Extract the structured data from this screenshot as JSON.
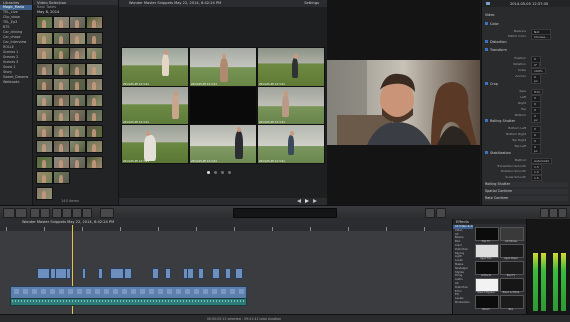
{
  "library": {
    "header": "Libraries",
    "items": [
      {
        "label": "Magic_Maria",
        "selected": true
      },
      {
        "label": "TEL_Live",
        "selected": false
      },
      {
        "label": "Clip_show",
        "selected": false
      },
      {
        "label": "TEL_Ep3",
        "selected": false
      },
      {
        "label": "BTS",
        "selected": false
      },
      {
        "label": "Car_driving",
        "selected": false
      },
      {
        "label": "Car_chase",
        "selected": false
      },
      {
        "label": "Car_Interview",
        "selected": false
      },
      {
        "label": "ROLLE",
        "selected": false
      },
      {
        "label": "Scenes 1",
        "selected": false
      },
      {
        "label": "Scenes 2",
        "selected": false
      },
      {
        "label": "Scenes 3",
        "selected": false
      },
      {
        "label": "Snow 1",
        "selected": false
      },
      {
        "label": "Story",
        "selected": false
      },
      {
        "label": "Sweet_Dreams",
        "selected": false
      },
      {
        "label": "Webisode",
        "selected": false
      }
    ]
  },
  "browser": {
    "header": "Video Selection",
    "subheader": "Best Takes",
    "date_label": "May 8, 2014",
    "footer": "140 items"
  },
  "viewer_grid": {
    "title": "Wonder Master Snippets May 22, 2014, 6:42:24 PM",
    "settings_label": "Settings",
    "timecodes": [
      "2014-05-05 12:3:21",
      "2014-05-05 12:3:21",
      "2014-05-05 12:3:21",
      "2014-05-05 12:3:21",
      "",
      "2014-05-05 12:3:21",
      "2014-05-05 12:3:21",
      "2014-05-05 12:3:21",
      "2014-05-05 12:3:21"
    ]
  },
  "inspector": {
    "header": "2014-05-05 12:37:45",
    "sections": {
      "video": "Video",
      "color": "Color",
      "distortion": "Distortion",
      "transform": "Transform",
      "crop": "Crop",
      "spatial": "Spatial Conform",
      "rolling": "Rolling Shutter",
      "stabilization": "Stabilization",
      "rate": "Rate Conform"
    },
    "color_props": [
      {
        "label": "Balance",
        "value": "Not Analyzed"
      },
      {
        "label": "Match Color",
        "value": "Choose..."
      }
    ],
    "transform_props": [
      {
        "label": "Position",
        "value": "0 px"
      },
      {
        "label": "Rotation",
        "value": "0°"
      },
      {
        "label": "Scale",
        "value": "100%"
      },
      {
        "label": "Anchor",
        "value": "0 px"
      }
    ],
    "crop_props": [
      {
        "label": "Type",
        "value": "Trim"
      },
      {
        "label": "Left",
        "value": "0 px"
      },
      {
        "label": "Right",
        "value": "0 px"
      },
      {
        "label": "Top",
        "value": "0 px"
      },
      {
        "label": "Bottom",
        "value": "0 px"
      }
    ],
    "distort_props": [
      {
        "label": "Bottom Left",
        "value": "0 px"
      },
      {
        "label": "Bottom Right",
        "value": "0 px"
      },
      {
        "label": "Top Right",
        "value": "0 px"
      },
      {
        "label": "Top Left",
        "value": "0 px"
      }
    ],
    "stab_props": [
      {
        "label": "Method",
        "value": "Automatic"
      },
      {
        "label": "Translation Smooth",
        "value": "1.5"
      },
      {
        "label": "Rotation Smooth",
        "value": "1.5"
      },
      {
        "label": "Scale Smooth",
        "value": "1.5"
      }
    ]
  },
  "timeline": {
    "project_name": "Wonder Master Snippets May 22, 2014, 6:42:24 PM"
  },
  "effects": {
    "header": "Effects",
    "categories": [
      "All Video & Audio",
      "Video",
      "All",
      "Basics",
      "Blur",
      "Color",
      "Distortion",
      "Keying",
      "Light",
      "Looks",
      "Masks",
      "Nostalgia",
      "Stylize",
      "Tiling",
      "Audio",
      "All",
      "Distortion",
      "Echo",
      "EQ",
      "Levels",
      "Modulation"
    ],
    "items": [
      "50s TV",
      "Add Noise",
      "Aged Film",
      "Aged Paper",
      "Artifacts",
      "Bad TV",
      "Bleach Bypass",
      "Black & White",
      "Bloom",
      "Blur"
    ]
  },
  "status": {
    "text": "00:00:05:13 selected - 09:01:41 total duration"
  }
}
